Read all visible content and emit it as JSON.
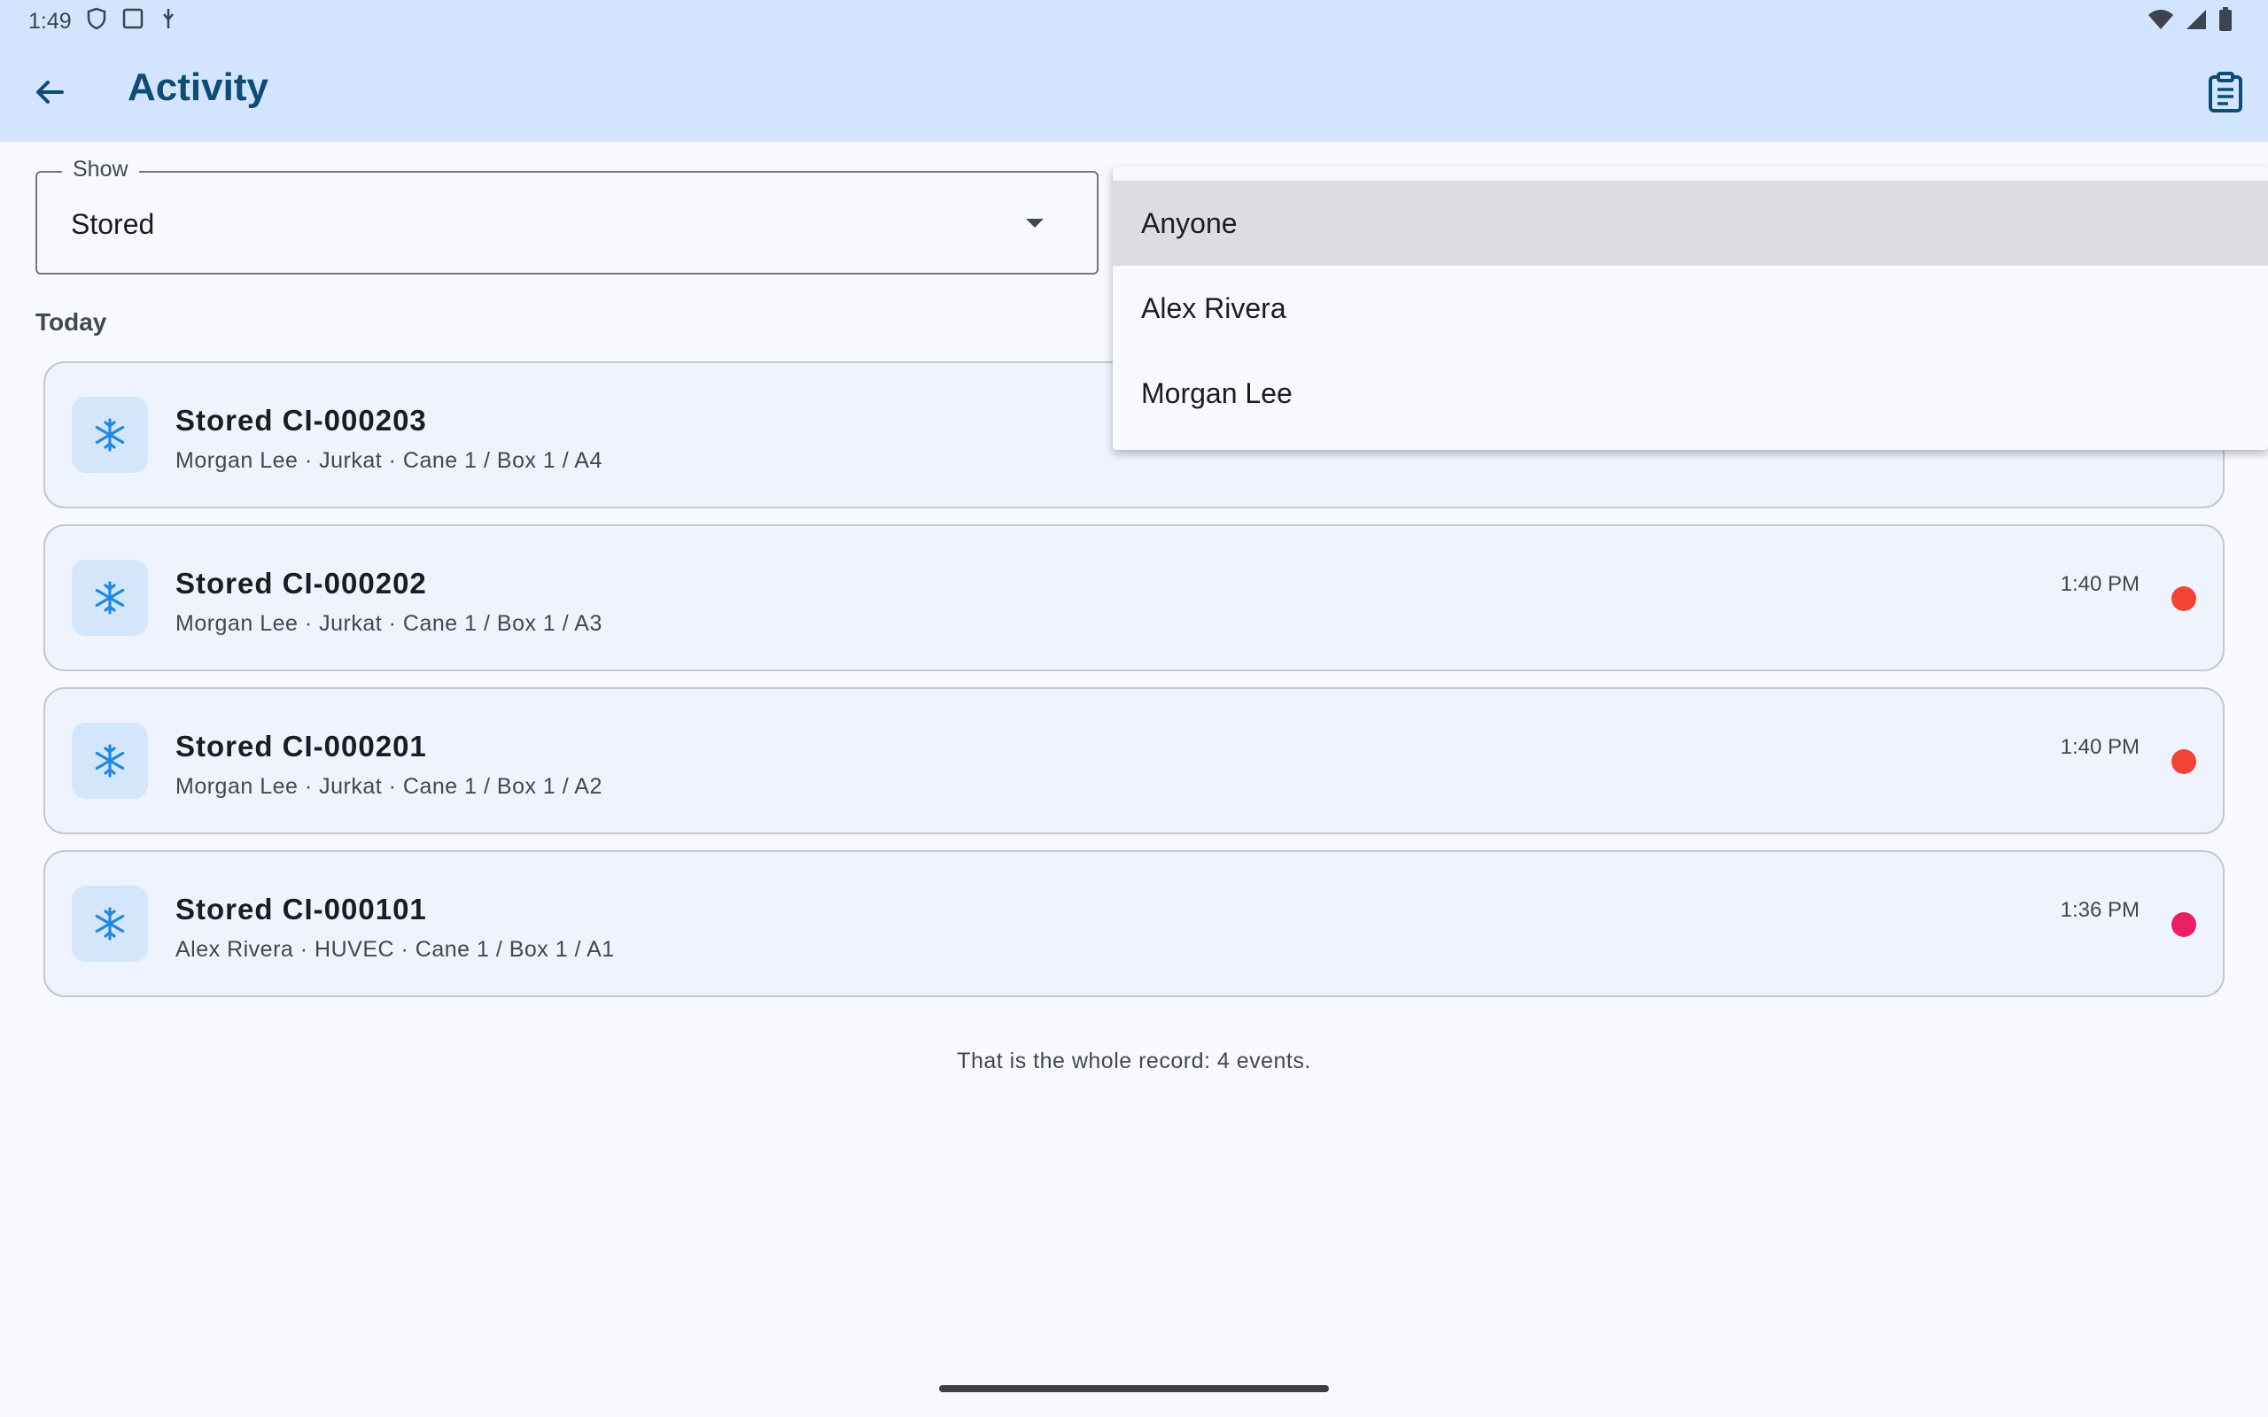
{
  "status_bar": {
    "time": "1:49",
    "icons": [
      "shield-icon",
      "screen-icon",
      "usb-icon",
      "wifi-icon",
      "signal-icon",
      "battery-icon"
    ]
  },
  "app_bar": {
    "title": "Activity",
    "back_icon": "arrow-back-icon",
    "action_icon": "clipboard-icon"
  },
  "filter": {
    "label": "Show",
    "value": "Stored"
  },
  "section": {
    "title": "Today"
  },
  "events": [
    {
      "title": "Stored CI-000203",
      "subtitle": "Morgan Lee · Jurkat · Cane 1 / Box 1 / A4",
      "time": "",
      "dot_color": ""
    },
    {
      "title": "Stored CI-000202",
      "subtitle": "Morgan Lee · Jurkat · Cane 1 / Box 1 / A3",
      "time": "1:40 PM",
      "dot_color": "#f44336"
    },
    {
      "title": "Stored CI-000201",
      "subtitle": "Morgan Lee · Jurkat · Cane 1 / Box 1 / A2",
      "time": "1:40 PM",
      "dot_color": "#f44336"
    },
    {
      "title": "Stored CI-000101",
      "subtitle": "Alex Rivera · HUVEC · Cane 1 / Box 1 / A1",
      "time": "1:36 PM",
      "dot_color": "#e91e63"
    }
  ],
  "footer": {
    "note": "That is the whole record: 4 events."
  },
  "dropdown": {
    "options": [
      "Anyone",
      "Alex Rivera",
      "Morgan Lee"
    ],
    "selected": "Anyone"
  },
  "colors": {
    "accent": "#0f4c75",
    "snowflake": "#1e88e5",
    "top_bar": "#d2e4fe"
  }
}
